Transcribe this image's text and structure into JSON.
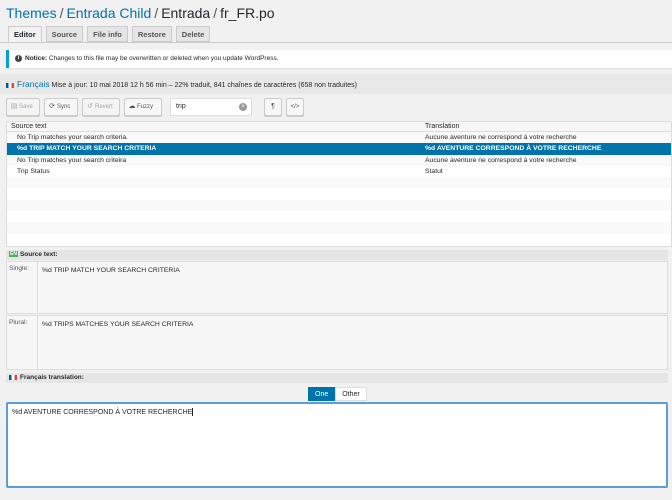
{
  "breadcrumb": {
    "themes": "Themes",
    "sep": "/",
    "child": "Entrada Child",
    "parent": "Entrada",
    "file": "fr_FR.po"
  },
  "tabs": [
    "Editor",
    "Source",
    "File info",
    "Restore",
    "Delete"
  ],
  "notice": {
    "strong": "Notice:",
    "text": "Changes to this file may be overwritten or deleted when you update WordPress."
  },
  "language": {
    "name": "Français",
    "meta": "Mise à jour: 10 mai 2018 12 h 56 min – 22% traduit, 841 chaînes de caractères (658 non traduites)"
  },
  "toolbar": {
    "save": "Save",
    "sync": "Sync",
    "revert": "Revert",
    "fuzzy": "Fuzzy",
    "search_value": "trip",
    "pilcrow": "¶",
    "code": "</>"
  },
  "grid": {
    "columns": [
      "Source text",
      "Translation"
    ],
    "rows": [
      {
        "source": "No Trip matches your search criteria.",
        "translation": "Aucune aventure ne correspond à votre recherche"
      },
      {
        "source": "%d TRIP MATCH YOUR SEARCH CRITERIA",
        "translation": "%d AVENTURE CORRESPOND À VOTRE RECHERCHE"
      },
      {
        "source": "No Trip matches your search criteira",
        "translation": "Aucune aventure ne correspond à votre recherche"
      },
      {
        "source": "Trip Status",
        "translation": "Statut"
      }
    ]
  },
  "source_panel": {
    "badge": "EN",
    "title": "Source text:",
    "single_label": "Single:",
    "single": "%d TRIP MATCH YOUR SEARCH CRITERIA",
    "plural_label": "Plural:",
    "plural": "%d TRIPS MATCHES YOUR SEARCH CRITERIA"
  },
  "translation_panel": {
    "title": "Français translation:",
    "forms": [
      "One",
      "Other"
    ],
    "value": "%d AVENTURE CORRESPOND À VOTRE RECHERCHE"
  },
  "colors": {
    "accent": "#0073aa",
    "notice_border": "#00a0d2",
    "focus_border": "#5b9dd9"
  }
}
